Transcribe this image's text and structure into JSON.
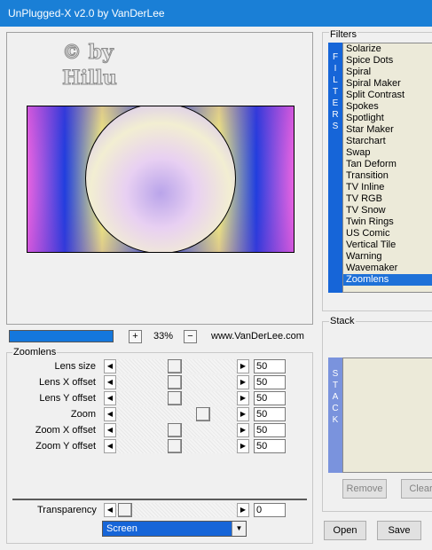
{
  "window": {
    "title": "UnPlugged-X v2.0 by VanDerLee"
  },
  "preview": {
    "watermark_line1": "© by",
    "watermark_line2": "Hillu"
  },
  "zoom": {
    "plus": "+",
    "value": "33%",
    "minus": "−",
    "website": "www.VanDerLee.com"
  },
  "params": {
    "group_label": "Zoomlens",
    "rows": [
      {
        "label": "Lens size",
        "value": "50"
      },
      {
        "label": "Lens X offset",
        "value": "50"
      },
      {
        "label": "Lens Y offset",
        "value": "50"
      },
      {
        "label": "Zoom",
        "value": "50"
      },
      {
        "label": "Zoom X offset",
        "value": "50"
      },
      {
        "label": "Zoom Y offset",
        "value": "50"
      }
    ],
    "transparency": {
      "label": "Transparency",
      "value": "0"
    },
    "blend_mode": "Screen"
  },
  "filters": {
    "label": "Filters",
    "side": "FILTERS",
    "items": [
      "Solarize",
      "Spice Dots",
      "Spiral",
      "Spiral Maker",
      "Split Contrast",
      "Spokes",
      "Spotlight",
      "Star Maker",
      "Starchart",
      "Swap",
      "Tan Deform",
      "Transition",
      "TV Inline",
      "TV RGB",
      "TV Snow",
      "Twin Rings",
      "US Comic",
      "Vertical Tile",
      "Warning",
      "Wavemaker",
      "Zoomlens"
    ],
    "selected": "Zoomlens"
  },
  "stack": {
    "label": "Stack",
    "side": "STACK",
    "remove": "Remove",
    "clear": "Clear"
  },
  "buttons": {
    "open": "Open",
    "save": "Save"
  },
  "icons": {
    "left": "arrow-left-icon",
    "right": "arrow-right-icon",
    "dropdown": "chevron-down-icon"
  }
}
